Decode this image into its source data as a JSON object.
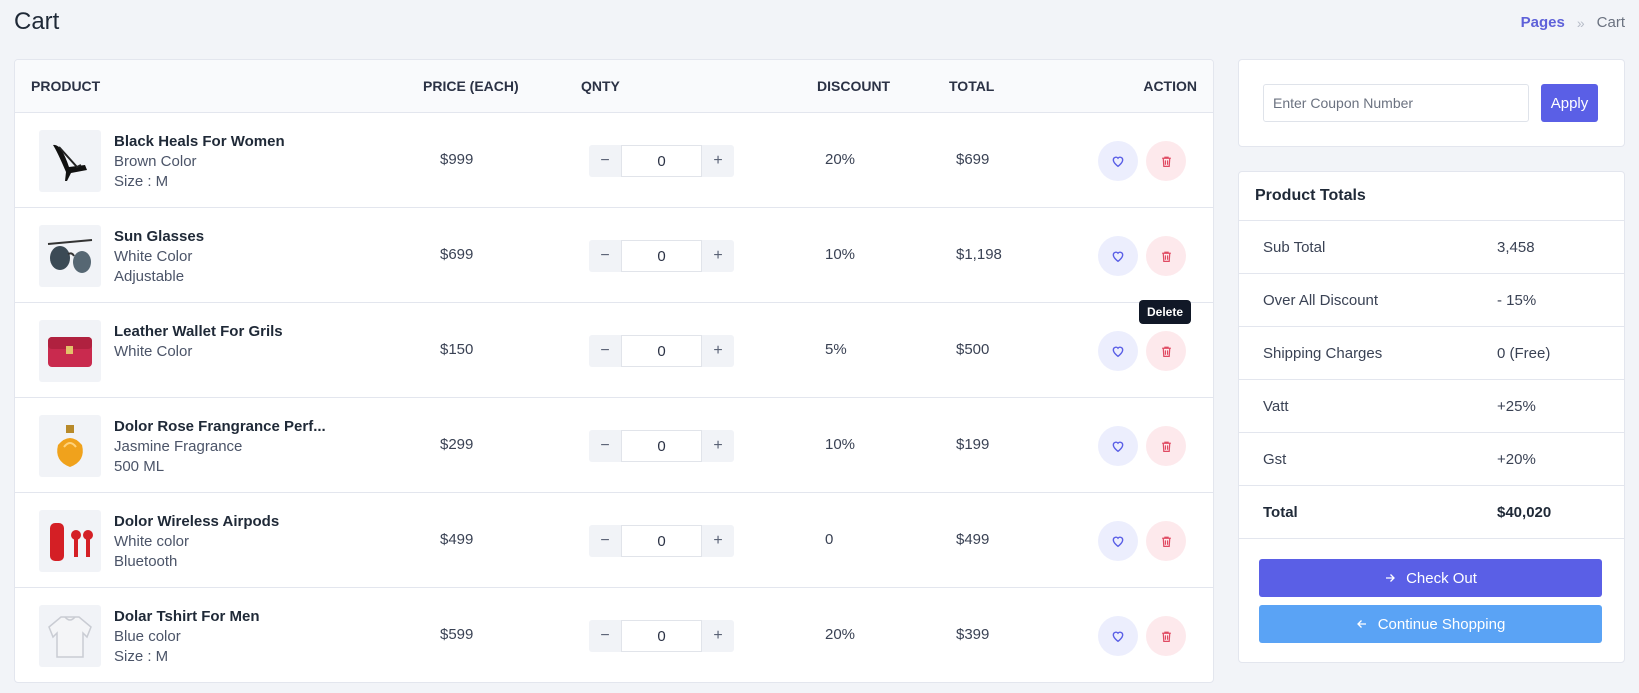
{
  "page": {
    "title": "Cart"
  },
  "breadcrumb": {
    "parent": "Pages",
    "separator": "»",
    "current": "Cart"
  },
  "table": {
    "headers": {
      "product": "PRODUCT",
      "price": "PRICE (EACH)",
      "qty": "QNTY",
      "discount": "DISCOUNT",
      "total": "TOTAL",
      "action": "ACTION"
    },
    "rows": [
      {
        "name": "Black Heals For Women",
        "meta1": "Brown Color",
        "meta2": "Size : M",
        "price": "$999",
        "qty": "0",
        "discount": "20%",
        "total": "$699",
        "icon": "heels-icon"
      },
      {
        "name": "Sun Glasses",
        "meta1": "White Color",
        "meta2": "Adjustable",
        "price": "$699",
        "qty": "0",
        "discount": "10%",
        "total": "$1,198",
        "icon": "sunglasses-icon"
      },
      {
        "name": "Leather Wallet For Grils",
        "meta1": "White Color",
        "meta2": "",
        "price": "$150",
        "qty": "0",
        "discount": "5%",
        "total": "$500",
        "icon": "wallet-icon"
      },
      {
        "name": "Dolor Rose Frangrance Perf...",
        "meta1": "Jasmine Fragrance",
        "meta2": "500 ML",
        "price": "$299",
        "qty": "0",
        "discount": "10%",
        "total": "$199",
        "icon": "perfume-icon"
      },
      {
        "name": "Dolor Wireless Airpods",
        "meta1": "White color",
        "meta2": "Bluetooth",
        "price": "$499",
        "qty": "0",
        "discount": "0",
        "total": "$499",
        "icon": "airpods-icon"
      },
      {
        "name": "Dolar Tshirt For Men",
        "meta1": "Blue color",
        "meta2": "Size : M",
        "price": "$599",
        "qty": "0",
        "discount": "20%",
        "total": "$399",
        "icon": "tshirt-icon"
      }
    ],
    "qty_minus": "−",
    "qty_plus": "+"
  },
  "tooltip": {
    "text": "Delete"
  },
  "coupon": {
    "placeholder": "Enter Coupon Number",
    "button": "Apply"
  },
  "totals": {
    "title": "Product Totals",
    "rows": [
      {
        "label": "Sub Total",
        "value": "3,458"
      },
      {
        "label": "Over All Discount",
        "value": "- 15%"
      },
      {
        "label": "Shipping Charges",
        "value": "0 (Free)"
      },
      {
        "label": "Vatt",
        "value": "+25%"
      },
      {
        "label": "Gst",
        "value": "+20%"
      },
      {
        "label": "Total",
        "value": "$40,020"
      }
    ],
    "checkout": "Check Out",
    "continue": "Continue Shopping"
  },
  "colors": {
    "accent": "#5a5fe6",
    "secondary": "#5aa3f5",
    "fav_bg": "#eceefd",
    "delete_bg": "#fde9ec",
    "delete_icon": "#e04a62"
  }
}
